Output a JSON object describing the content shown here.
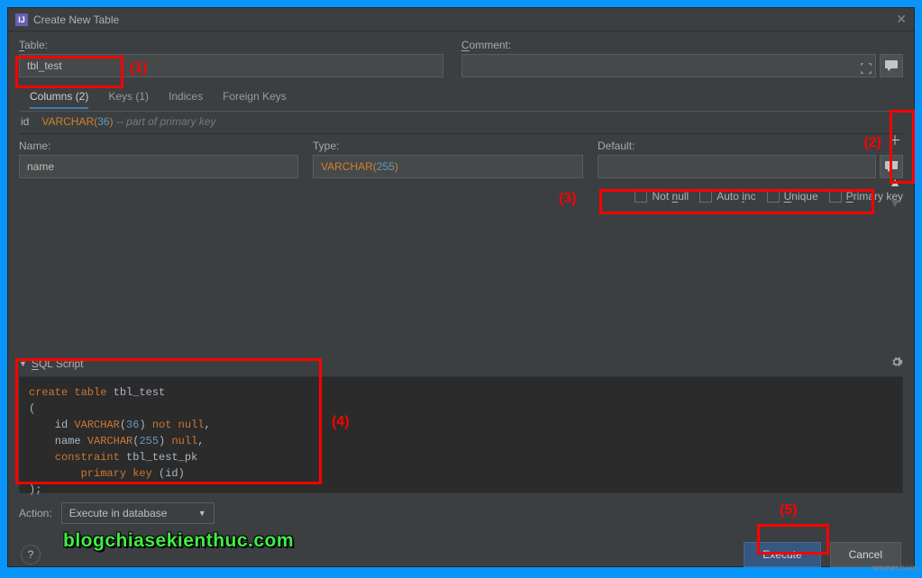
{
  "window": {
    "title": "Create New Table"
  },
  "labels": {
    "table": "Table:",
    "comment": "Comment:",
    "name": "Name:",
    "type": "Type:",
    "default": "Default:",
    "action": "Action:",
    "sql_script": "SQL Script"
  },
  "values": {
    "table_name": "tbl_test",
    "column_name": "name",
    "column_type_prefix": "VARCHAR(",
    "column_type_num": "255",
    "column_type_suffix": ")",
    "action_select": "Execute in database"
  },
  "tabs": {
    "columns": "Columns (2)",
    "keys": "Keys (1)",
    "indices": "Indices",
    "foreign_keys": "Foreign Keys"
  },
  "columnRow": {
    "name": "id",
    "type_prefix": "VARCHAR(",
    "type_num": "36",
    "type_suffix": ")",
    "comment": "-- part of primary key"
  },
  "checks": {
    "not_null": "Not null",
    "auto_inc": "Auto inc",
    "unique": "Unique",
    "primary_key": "Primary key"
  },
  "sql": {
    "l1_kw": "create table ",
    "l1_nm": "tbl_test",
    "l2": "(",
    "l3_nm": "    id ",
    "l3_ty": "VARCHAR",
    "l3_num": "36",
    "l3_kw": " not null",
    "l4_nm": "    name ",
    "l4_ty": "VARCHAR",
    "l4_num": "255",
    "l4_kw": " null",
    "l5_kw": "    constraint ",
    "l5_nm": "tbl_test_pk",
    "l6_kw": "        primary key ",
    "l6_nm": "id",
    "l7": ");"
  },
  "buttons": {
    "execute": "Execute",
    "cancel": "Cancel"
  },
  "watermark": "blogchiasekienthuc.com",
  "bottomRight": "wsxvn.com",
  "annotations": {
    "a1": "(1)",
    "a2": "(2)",
    "a3": "(3)",
    "a4": "(4)",
    "a5": "(5)"
  }
}
